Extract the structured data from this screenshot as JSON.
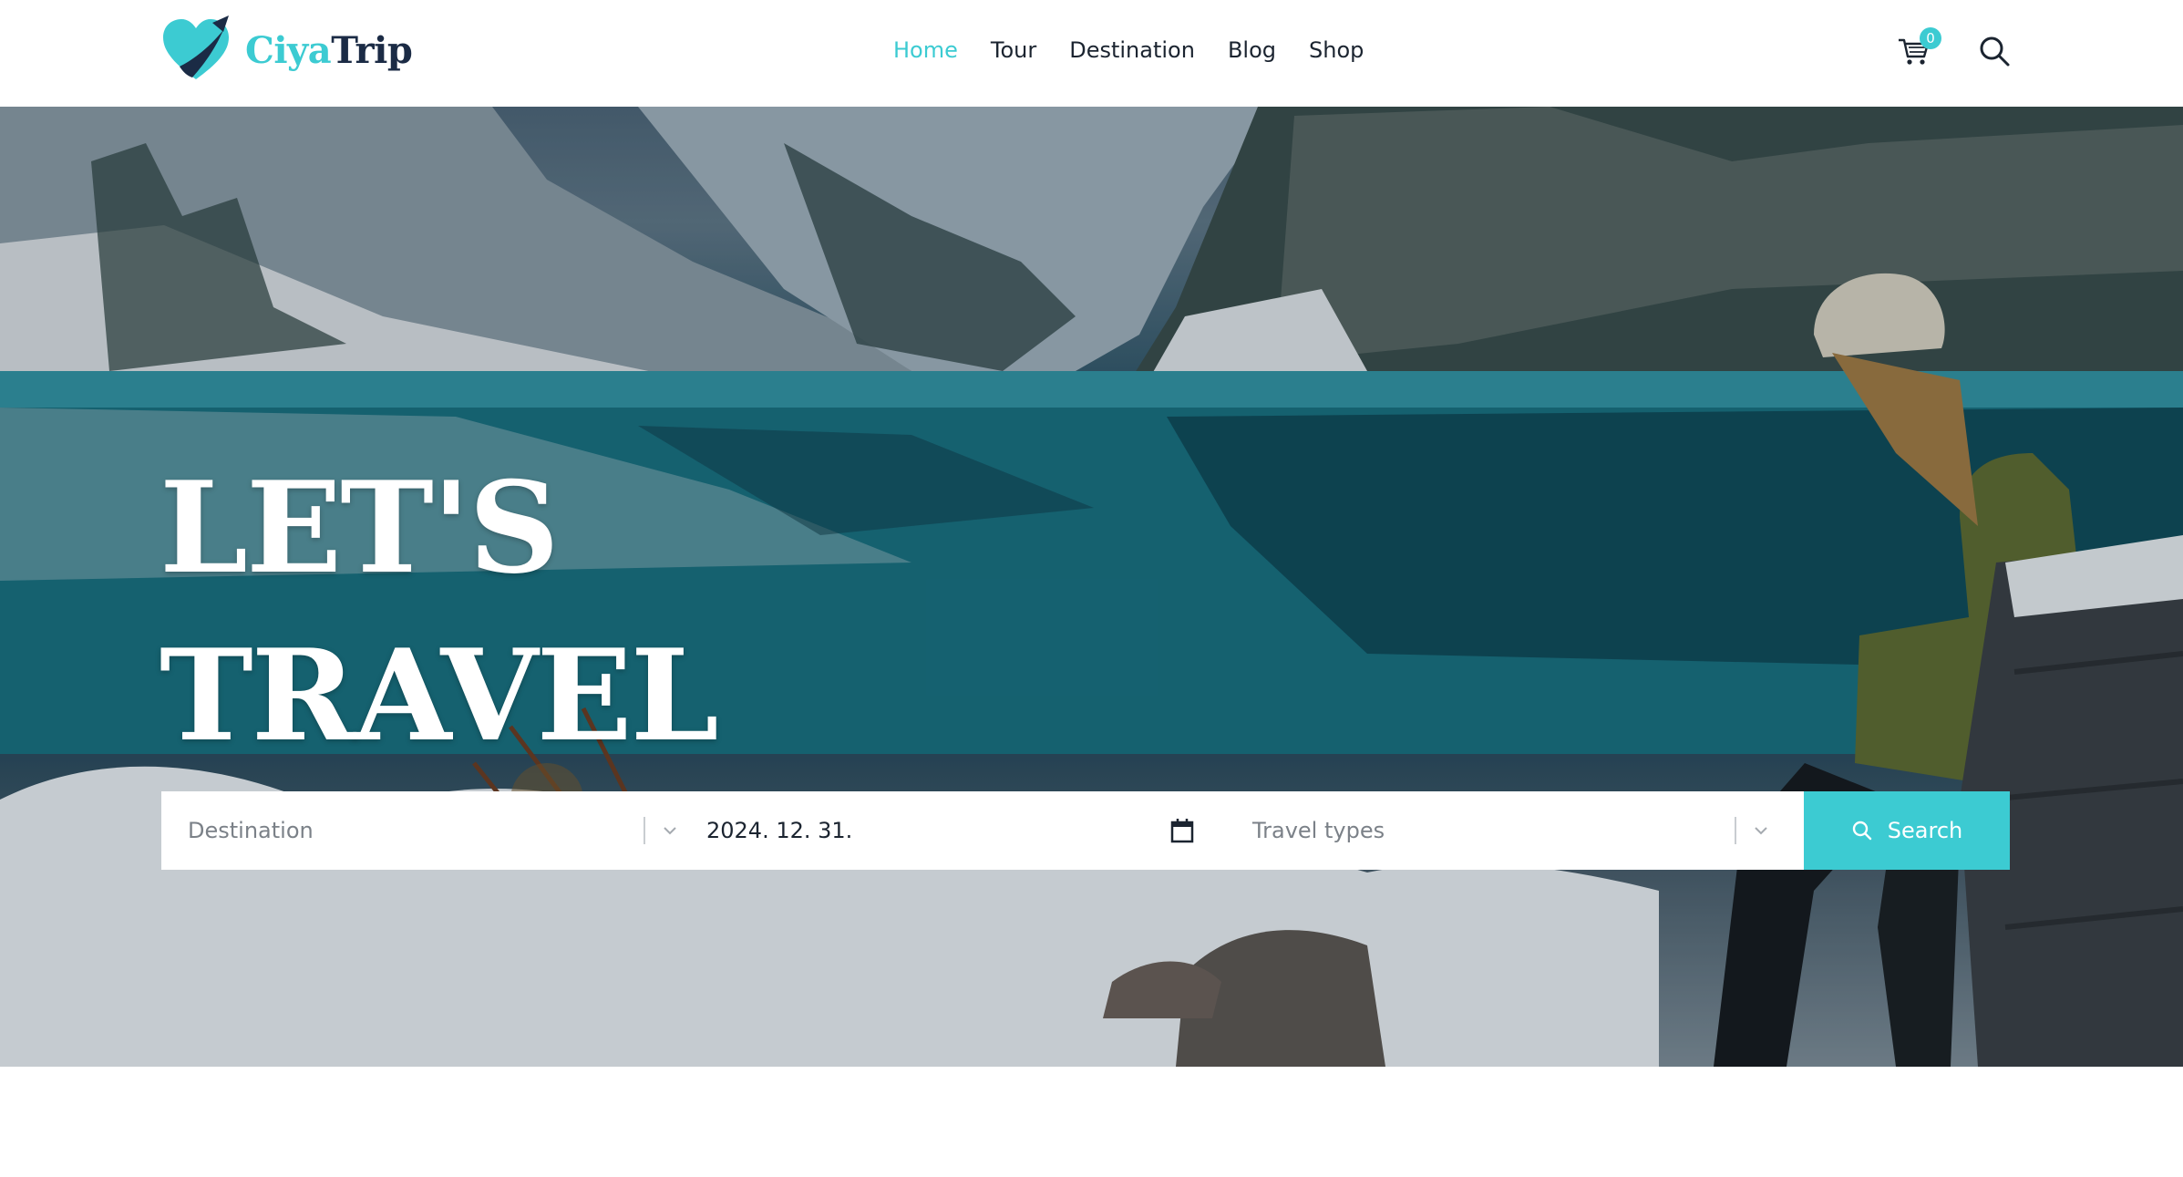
{
  "brand": {
    "name_part1": "Ciya",
    "name_part2": "Trip",
    "accent_color": "#3ccbd2",
    "dark_color": "#1b2b45"
  },
  "nav": {
    "items": [
      {
        "label": "Home",
        "active": true
      },
      {
        "label": "Tour",
        "active": false
      },
      {
        "label": "Destination",
        "active": false
      },
      {
        "label": "Blog",
        "active": false
      },
      {
        "label": "Shop",
        "active": false
      }
    ]
  },
  "header_actions": {
    "cart_icon": "cart-icon",
    "cart_count": "0",
    "search_icon": "search-icon"
  },
  "hero": {
    "title_line1": "LET'S",
    "title_line2": "TRAVEL"
  },
  "search_form": {
    "destination_placeholder": "Destination",
    "date_value": "2024. 12. 31.",
    "travel_types_placeholder": "Travel types",
    "search_label": "Search"
  }
}
